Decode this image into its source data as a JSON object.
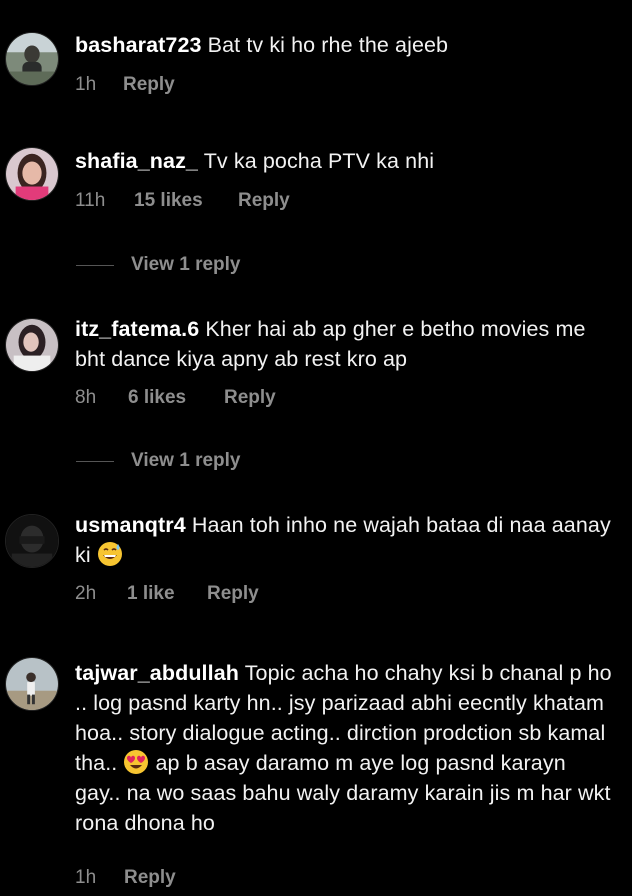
{
  "comments": [
    {
      "username": "basharat723",
      "text": "Bat tv ki ho rhe the ajeeb",
      "time": "1h",
      "likes": "",
      "reply_label": "Reply"
    },
    {
      "username": "shafia_naz_",
      "text": "Tv ka pocha PTV ka nhi",
      "time": "11h",
      "likes": "15 likes",
      "reply_label": "Reply",
      "view_replies": "View 1 reply"
    },
    {
      "username": "itz_fatema.6",
      "text": "Kher hai ab ap gher e betho movies me bht dance kiya apny ab rest kro ap",
      "time": "8h",
      "likes": "6 likes",
      "reply_label": "Reply",
      "view_replies": "View 1 reply"
    },
    {
      "username": "usmanqtr4",
      "text": "Haan toh inho ne wajah bataa di naa aanay ki",
      "time": "2h",
      "likes": "1 like",
      "reply_label": "Reply",
      "emoji": "grinning-sweat-emoji"
    },
    {
      "username": "tajwar_abdullah",
      "text_part1": "Topic acha ho chahy ksi b chanal p ho .. log pasnd karty hn.. jsy parizaad abhi eecntly khatam hoa.. story dialogue acting.. dirction prodction sb kamal tha..",
      "text_part2": "ap b asay daramo m aye log pasnd karayn gay.. na wo saas bahu waly daramy karain jis m har wkt rona dhona ho",
      "time": "1h",
      "likes": "",
      "reply_label": "Reply",
      "emoji": "heart-eyes-emoji"
    }
  ],
  "colors": {
    "background": "#000000",
    "text": "#f2f2f2",
    "meta": "#8e8e8e"
  }
}
